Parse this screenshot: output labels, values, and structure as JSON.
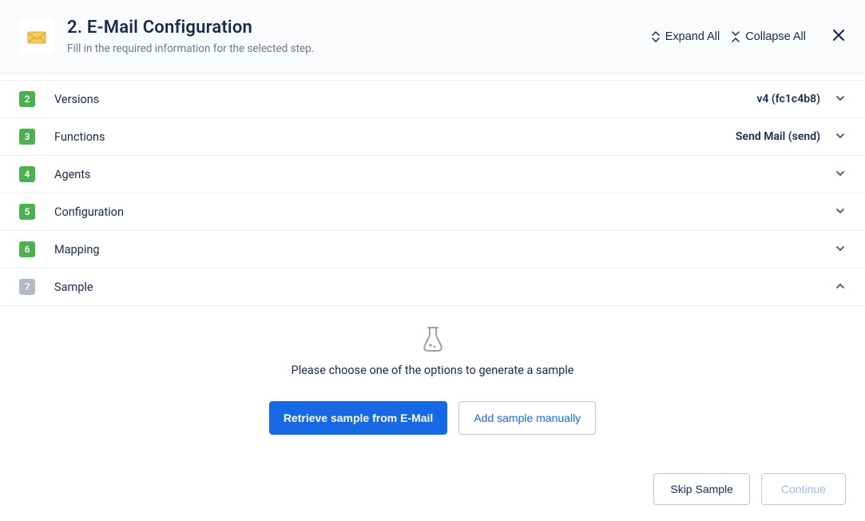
{
  "header": {
    "title": "2. E-Mail Configuration",
    "subtitle": "Fill in the required information for the selected step.",
    "expand_label": "Expand All",
    "collapse_label": "Collapse All"
  },
  "rows": [
    {
      "num": "2",
      "label": "Versions",
      "value": "v4 (fc1c4b8)",
      "num_color": "green",
      "open": false
    },
    {
      "num": "3",
      "label": "Functions",
      "value": "Send Mail (send)",
      "num_color": "green",
      "open": false
    },
    {
      "num": "4",
      "label": "Agents",
      "value": "",
      "num_color": "green",
      "open": false
    },
    {
      "num": "5",
      "label": "Configuration",
      "value": "",
      "num_color": "green",
      "open": false
    },
    {
      "num": "6",
      "label": "Mapping",
      "value": "",
      "num_color": "green",
      "open": false
    },
    {
      "num": "7",
      "label": "Sample",
      "value": "",
      "num_color": "gray",
      "open": true
    }
  ],
  "sample": {
    "prompt": "Please choose one of the options to generate a sample",
    "retrieve_label": "Retrieve sample from E-Mail",
    "add_label": "Add sample manually"
  },
  "footer": {
    "skip_label": "Skip Sample",
    "continue_label": "Continue"
  }
}
